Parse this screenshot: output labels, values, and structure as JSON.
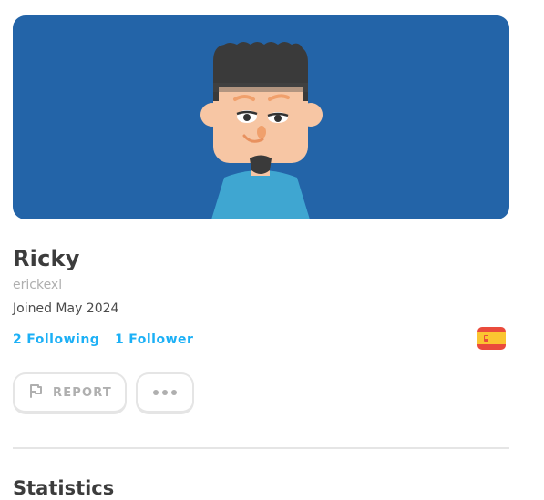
{
  "profile": {
    "display_name": "Ricky",
    "username": "erickexl",
    "joined": "Joined May 2024",
    "following_count": "2",
    "following_label": "Following",
    "followers_count": "1",
    "followers_label": "Follower",
    "course_flag": "spain-flag-icon"
  },
  "actions": {
    "report_label": "REPORT",
    "report_icon": "flag-outline-icon",
    "more_icon": "more-dots-icon"
  },
  "sections": {
    "statistics_title": "Statistics"
  },
  "colors": {
    "banner_bg": "#2364a8",
    "link": "#1cb0f6",
    "text_primary": "#3c3c3c",
    "text_muted": "#afafaf",
    "border": "#e5e5e5"
  }
}
